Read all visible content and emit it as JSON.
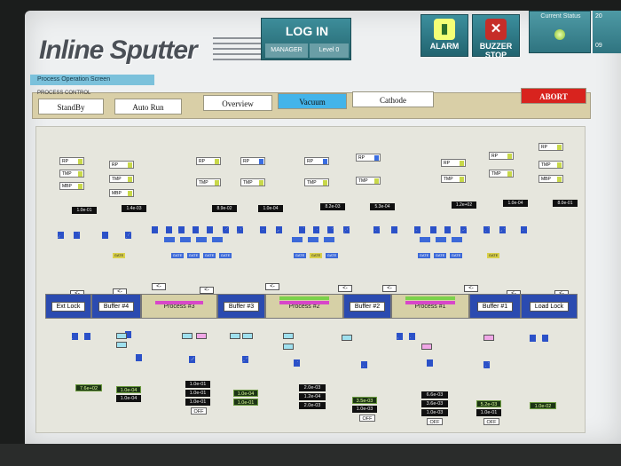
{
  "app": {
    "title": "Inline Sputter"
  },
  "header": {
    "login_label": "LOG IN",
    "user": "MANAGER",
    "level": "Level 0",
    "alarm_label": "ALARM",
    "buzzer_label": "BUZZER STOP",
    "status_label": "Current Status",
    "clock_partial": "20",
    "clock_partial2": "09"
  },
  "screen_tab": "Process Operation Screen",
  "process_control": {
    "label": "PROCESS CONTROL",
    "standby": "StandBy",
    "auto_run": "Auto Run",
    "overview": "Overview",
    "vacuum": "Vacuum",
    "cathode": "Cathode",
    "abort": "ABORT"
  },
  "colors": {
    "accent": "#43b4ea",
    "abort": "#d8231e",
    "header": "#2f7480",
    "chamber": "#2b4bb0"
  },
  "diagram": {
    "pump_labels": {
      "rp": "RP",
      "tmp": "TMP",
      "mbp": "MBP"
    },
    "upper_gauges": [
      "1.0e-01",
      "1.4e-03",
      "8.9e-02",
      "1.0e-04",
      "8.2e-03",
      "5.3e-04",
      "1.2e+02",
      "1.0e-04",
      "8.0e-01"
    ],
    "chambers": [
      "Ext Lock",
      "Buffer #4",
      "Process #3",
      "Buffer #3",
      "Process #2",
      "Buffer #2",
      "Process #1",
      "Buffer #1",
      "Load Lock"
    ],
    "lower_readings": {
      "ext_lock": "7.6e+02",
      "buffer4": [
        "1.0e-04",
        "1.0e-04"
      ],
      "process3": [
        "1.0e-01",
        "1.0e-01",
        "1.0e-01"
      ],
      "buffer3": [
        "1.0e-04",
        "1.0e-01"
      ],
      "process2": [
        "2.0e-03",
        "1.2e-04",
        "2.0e-03"
      ],
      "buffer2": [
        "3.5e-03",
        "1.0e-03"
      ],
      "process1": [
        "6.6e-03",
        "3.6e-03",
        "1.0e-03"
      ],
      "buffer1": [
        "5.2e-03",
        "1.0e-01"
      ],
      "load_lock": "1.0e-02"
    },
    "off_label": "OFF",
    "gate_label": "GATE",
    "arrow_label": "<-"
  }
}
